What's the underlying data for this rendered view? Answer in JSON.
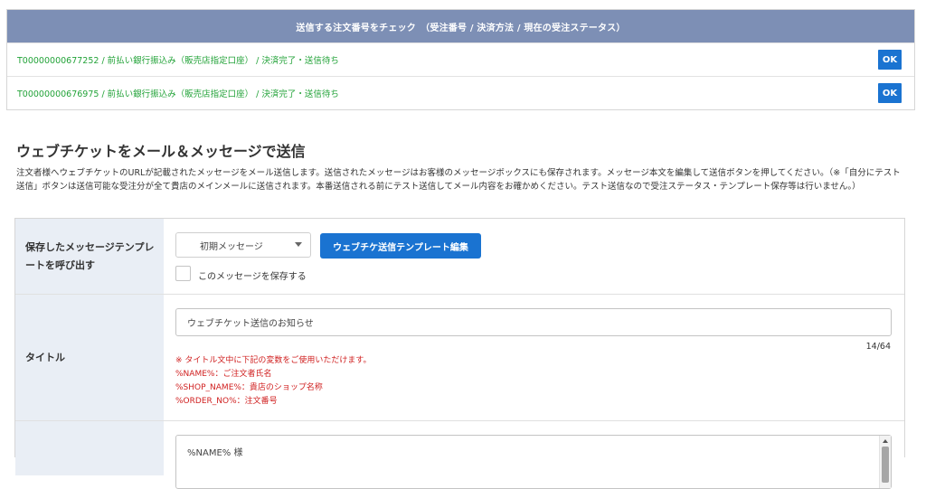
{
  "check_panel": {
    "header": "送信する注文番号をチェック　（受注番号 / 決済方法 / 現在の受注ステータス）",
    "rows": [
      {
        "order": "T00000000677252 / 前払い銀行振込み（販売店指定口座） / 決済完了・送信待ち",
        "button": "OK"
      },
      {
        "order": "T00000000676975 / 前払い銀行振込み（販売店指定口座） / 決済完了・送信待ち",
        "button": "OK"
      }
    ]
  },
  "section": {
    "title": "ウェブチケットをメール＆メッセージで送信",
    "description": "注文者様へウェブチケットのURLが記載されたメッセージをメール送信します。送信されたメッセージはお客様のメッセージボックスにも保存されます。メッセージ本文を編集して送信ボタンを押してください。（※「自分にテスト送信」ボタンは送信可能な受注分が全て貴店のメインメールに送信されます。本番送信される前にテスト送信してメール内容をお確かめください。テスト送信なので受注ステータス・テンプレート保存等は行いません。）"
  },
  "template_row": {
    "label": "保存したメッセージテンプレートを呼び出す",
    "select_value": "初期メッセージ",
    "edit_button": "ウェブチケ送信テンプレート編集",
    "save_checkbox_label": "このメッセージを保存する"
  },
  "title_row": {
    "label": "タイトル",
    "value": "ウェブチケット送信のお知らせ",
    "counter": "14/64",
    "notes": [
      "※ タイトル文中に下記の変数をご使用いただけます。",
      "%NAME%：ご注文者氏名",
      "%SHOP_NAME%：貴店のショップ名称",
      "%ORDER_NO%：注文番号"
    ]
  },
  "body_row": {
    "label": "",
    "first_line": "%NAME% 様"
  }
}
